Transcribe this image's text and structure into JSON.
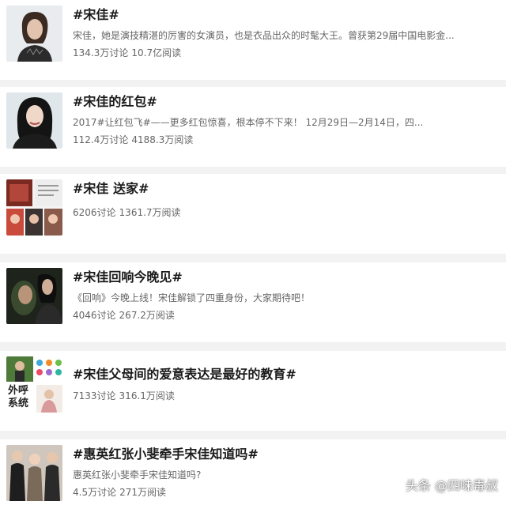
{
  "topics": [
    {
      "title": "#宋佳#",
      "desc": "宋佳，她是演技精湛的厉害的女演员，也是衣品出众的时髦大王。曾获第29届中国电影金...",
      "discussions": "134.3万讨论",
      "reads": "10.7亿阅读"
    },
    {
      "title": "#宋佳的红包#",
      "desc": "2017#让红包飞#——更多红包惊喜，根本停不下来！ 12月29日—2月14日，四...",
      "discussions": "112.4万讨论",
      "reads": "4188.3万阅读"
    },
    {
      "title": "#宋佳 送家#",
      "desc": "",
      "discussions": "6206讨论",
      "reads": "1361.7万阅读"
    },
    {
      "title": "#宋佳回响今晚见#",
      "desc": "《回响》今晚上线！宋佳解锁了四重身份，大家期待吧！",
      "discussions": "4046讨论",
      "reads": "267.2万阅读"
    },
    {
      "title": "#宋佳父母间的爱意表达是最好的教育#",
      "desc": "",
      "discussions": "7133讨论",
      "reads": "316.1万阅读",
      "thumb_text": [
        "外呼",
        "系统"
      ]
    },
    {
      "title": "#惠英红张小斐牵手宋佳知道吗#",
      "desc": "惠英红张小斐牵手宋佳知道吗?",
      "discussions": "4.5万讨论",
      "reads": "271万阅读"
    }
  ],
  "watermark": "头条 @四味毒叔",
  "colors": {
    "background": "#f2f2f2",
    "card": "#ffffff",
    "title": "#1a1a1a",
    "meta": "#666666"
  }
}
